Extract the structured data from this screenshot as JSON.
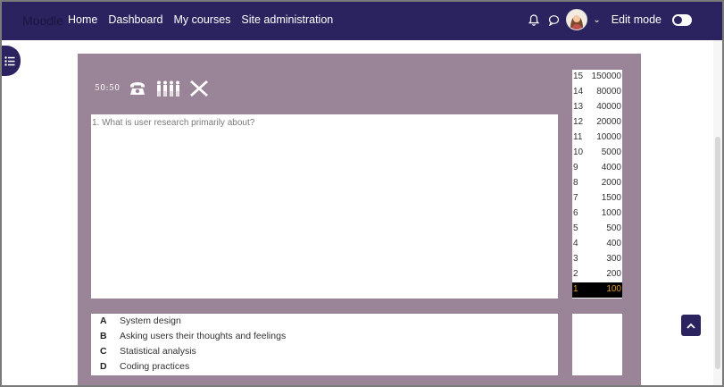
{
  "navbar": {
    "brand": "Moodle",
    "links": [
      "Home",
      "Dashboard",
      "My courses",
      "Site administration"
    ],
    "edit_mode_label": "Edit mode",
    "icons": [
      "bell-icon",
      "chat-icon",
      "avatar",
      "chevron-down-icon"
    ]
  },
  "game": {
    "lifelines": {
      "fifty_fifty": "50:50",
      "icons": [
        "phone-icon",
        "audience-icon",
        "close-icon"
      ]
    },
    "question": "1. What is user research primarily about?",
    "answers": [
      {
        "letter": "A",
        "text": "System design"
      },
      {
        "letter": "B",
        "text": "Asking users their thoughts and feelings"
      },
      {
        "letter": "C",
        "text": "Statistical analysis"
      },
      {
        "letter": "D",
        "text": "Coding practices"
      }
    ],
    "ladder": [
      {
        "level": "15",
        "amount": "150000"
      },
      {
        "level": "14",
        "amount": "80000"
      },
      {
        "level": "13",
        "amount": "40000"
      },
      {
        "level": "12",
        "amount": "20000"
      },
      {
        "level": "11",
        "amount": "10000"
      },
      {
        "level": "10",
        "amount": "5000"
      },
      {
        "level": "9",
        "amount": "4000"
      },
      {
        "level": "8",
        "amount": "2000"
      },
      {
        "level": "7",
        "amount": "1500"
      },
      {
        "level": "6",
        "amount": "1000"
      },
      {
        "level": "5",
        "amount": "500"
      },
      {
        "level": "4",
        "amount": "400"
      },
      {
        "level": "3",
        "amount": "300"
      },
      {
        "level": "2",
        "amount": "200"
      },
      {
        "level": "1",
        "amount": "100"
      }
    ],
    "current_level": "1"
  },
  "colors": {
    "navbar": "#2b2360",
    "panel": "#9a8598",
    "current_rung_text": "#e69a2a"
  }
}
